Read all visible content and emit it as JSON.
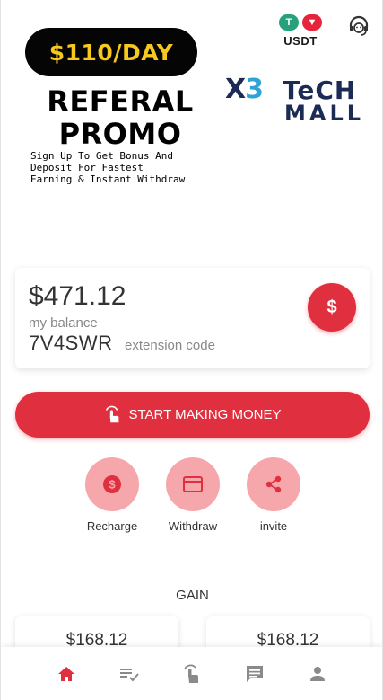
{
  "top": {
    "usdt_label": "USDT",
    "tether_glyph": "T",
    "tron_glyph": "▼"
  },
  "banner": {
    "pill_text": "$110/DAY",
    "title_line1": "REFERAL",
    "title_line2": "PROMO",
    "sub_line1": "Sign Up To Get Bonus And",
    "sub_line2": "Deposit For Fastest",
    "sub_line3": "Earning & Instant Withdraw",
    "logo_x": "X",
    "logo_3": "3",
    "logo_tech": "TeCH",
    "logo_mall": "MALL"
  },
  "balance": {
    "amount": "$471.12",
    "label": "my balance",
    "code": "7V4SWR",
    "code_label": "extension code",
    "button_symbol": "$"
  },
  "start": {
    "label": "START MAKING MONEY"
  },
  "actions": [
    {
      "label": "Recharge",
      "icon": "dollar-coin-icon"
    },
    {
      "label": "Withdraw",
      "icon": "card-icon"
    },
    {
      "label": "invite",
      "icon": "share-icon"
    }
  ],
  "gain": {
    "title": "GAIN",
    "cards": [
      {
        "value": "$168.12"
      },
      {
        "value": "$168.12"
      }
    ]
  },
  "nav": {
    "items": [
      {
        "icon": "home-icon",
        "active": true
      },
      {
        "icon": "task-list-icon",
        "active": false
      },
      {
        "icon": "tap-icon",
        "active": false
      },
      {
        "icon": "message-icon",
        "active": false
      },
      {
        "icon": "person-icon",
        "active": false
      }
    ]
  },
  "colors": {
    "accent": "#e0303f",
    "accent_light": "#f6a7ab",
    "nav_inactive": "#8a8a8a",
    "pill_text": "#f7c81e",
    "logo_dark": "#1c2a56",
    "logo_light": "#2ea4d6"
  }
}
